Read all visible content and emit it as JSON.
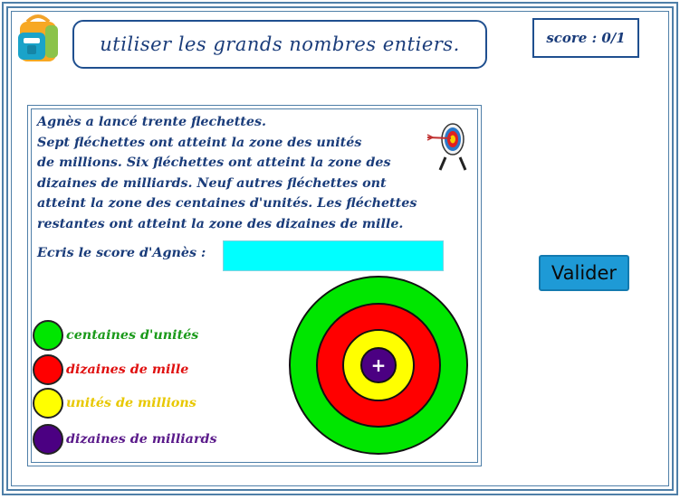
{
  "header": {
    "title": "utiliser les grands nombres entiers.",
    "score": "score : 0/1"
  },
  "problem": {
    "lines": [
      "Agnès a lancé trente flechettes.",
      "Sept fléchettes ont atteint la zone des unités",
      "de millions. Six fléchettes ont atteint la zone des",
      "dizaines de milliards. Neuf autres fléchettes ont",
      "atteint la zone des centaines d'unités. Les fléchettes",
      "restantes ont atteint la zone des dizaines de mille."
    ],
    "prompt": "Ecris le score d'Agnès :",
    "answer_value": "",
    "answer_placeholder": ""
  },
  "legend": [
    {
      "label": "centaines d'unités",
      "color": "#00e600",
      "text_color": "#1a9a1a"
    },
    {
      "label": "dizaines de mille",
      "color": "#ff0000",
      "text_color": "#e01010"
    },
    {
      "label": "unités de millions",
      "color": "#ffff00",
      "text_color": "#e8c800"
    },
    {
      "label": "dizaines de milliards",
      "color": "#4b0082",
      "text_color": "#5a1a8a"
    }
  ],
  "target": {
    "center_symbol": "+"
  },
  "buttons": {
    "validate_label": "Valider"
  }
}
